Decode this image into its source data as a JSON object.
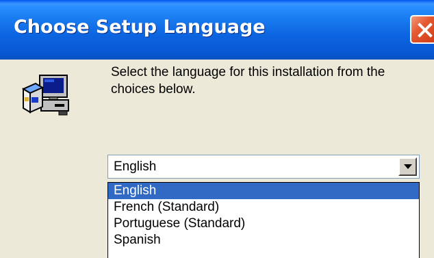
{
  "window": {
    "title": "Choose Setup Language"
  },
  "prompt": {
    "text": "Select the language for this installation from the choices below."
  },
  "language_select": {
    "selected": "English",
    "options": [
      "English",
      "French (Standard)",
      "Portuguese (Standard)",
      "Spanish"
    ],
    "highlighted_option": "English"
  },
  "icons": {
    "title_close": "close-icon",
    "setup": "setup-computer-icon",
    "dropdown": "chevron-down-icon"
  },
  "colors": {
    "title_bar": "#0a5ad6",
    "dialog_background": "#ece9d8",
    "selection": "#316ac5",
    "close_button": "#e4572f"
  }
}
